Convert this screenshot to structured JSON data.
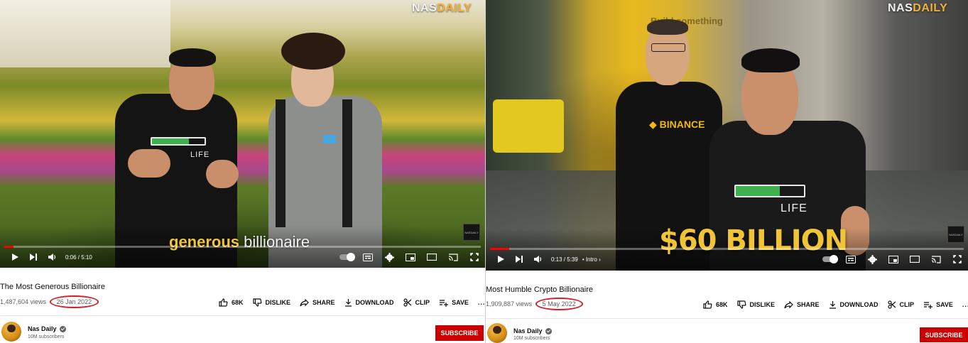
{
  "colors": {
    "progress": "#ff0000",
    "subscribe": "#cc0000",
    "date_circle": "#d3202c",
    "caption_yellow": "#f1c435"
  },
  "left": {
    "watermark_a": "NAS",
    "watermark_b": "DAILY",
    "caption_highlight": "generous",
    "caption_rest": "billionaire",
    "time": "0:06 / 5:10",
    "progress_fraction": 0.02,
    "title": "The Most Generous Billionaire",
    "views": "1,487,604 views",
    "date": "26 Jan 2022",
    "actions": {
      "like": "68K",
      "dislike": "DISLIKE",
      "share": "SHARE",
      "download": "DOWNLOAD",
      "clip": "CLIP",
      "save": "SAVE",
      "more": "..."
    },
    "channel": {
      "name": "Nas Daily",
      "subscribers": "10M subscribers",
      "subscribe_label": "SUBSCRIBE"
    },
    "corner_badge": "NASDAILY"
  },
  "right": {
    "watermark_a": "NAS",
    "watermark_b": "DAILY",
    "caption": "$60 BILLION",
    "shirt_text": "BINANCE",
    "wall_text": "Build something",
    "time": "0:13 / 5:39",
    "chapter": "• Intro ›",
    "progress_fraction": 0.04,
    "title": "Most Humble Crypto Billionaire",
    "views": "1,909,887 views",
    "date": "5 May 2022",
    "actions": {
      "like": "68K",
      "dislike": "DISLIKE",
      "share": "SHARE",
      "download": "DOWNLOAD",
      "clip": "CLIP",
      "save": "SAVE",
      "more": "..."
    },
    "channel": {
      "name": "Nas Daily",
      "subscribers": "10M subscribers",
      "subscribe_label": "SUBSCRIBE"
    },
    "corner_badge": "NASDAILY"
  }
}
